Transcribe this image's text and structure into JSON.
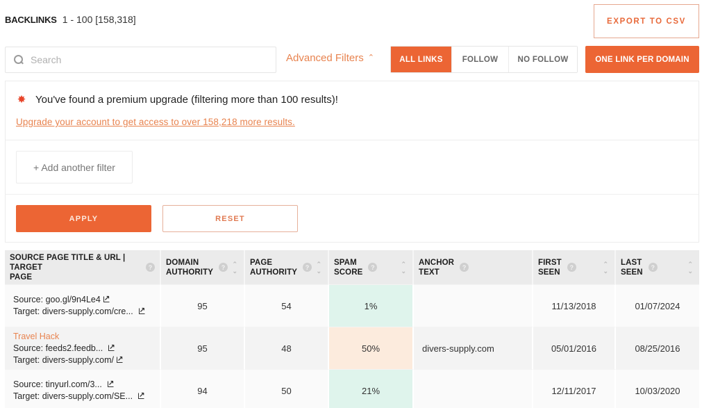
{
  "header": {
    "title": "BACKLINKS",
    "range": "1 - 100 [158,318]",
    "export_label": "EXPORT TO CSV"
  },
  "toolbar": {
    "search_placeholder": "Search",
    "search_value": "",
    "advanced_filters_label": "Advanced Filters",
    "advanced_filters_icon": "chevron-up-icon",
    "link_filters": [
      {
        "label": "ALL LINKS",
        "active": true
      },
      {
        "label": "FOLLOW",
        "active": false
      },
      {
        "label": "NO FOLLOW",
        "active": false
      }
    ],
    "one_link_per_domain_label": "ONE LINK PER DOMAIN"
  },
  "filter_panel": {
    "premium_icon": "burst-icon",
    "premium_message": "You've found a premium upgrade (filtering more than 100 results)!",
    "upgrade_link": "Upgrade your account to get access to over 158,218 more results.",
    "add_filter_label": "+ Add another filter",
    "apply_label": "APPLY",
    "reset_label": "RESET"
  },
  "table": {
    "columns": [
      {
        "label_line1": "SOURCE PAGE TITLE & URL | TARGET",
        "label_line2": "PAGE",
        "help": true,
        "sortable": false
      },
      {
        "label_line1": "DOMAIN",
        "label_line2": "AUTHORITY",
        "help": true,
        "sortable": true
      },
      {
        "label_line1": "PAGE",
        "label_line2": "AUTHORITY",
        "help": true,
        "sortable": true
      },
      {
        "label_line1": "SPAM",
        "label_line2": "SCORE",
        "help": true,
        "sortable": true
      },
      {
        "label_line1": "ANCHOR",
        "label_line2": "TEXT",
        "help": true,
        "sortable": false
      },
      {
        "label_line1": "FIRST",
        "label_line2": "SEEN",
        "help": true,
        "sortable": true
      },
      {
        "label_line1": "LAST",
        "label_line2": "SEEN",
        "help": true,
        "sortable": true
      }
    ],
    "rows": [
      {
        "page_title": "",
        "source": "goo.gl/9n4Le4",
        "target": "divers-supply.com/cre...",
        "domain_authority": "95",
        "page_authority": "54",
        "spam_score": "1%",
        "spam_level": "low",
        "anchor_text": "",
        "first_seen": "11/13/2018",
        "last_seen": "01/07/2024"
      },
      {
        "page_title": "Travel Hack",
        "source": "feeds2.feedb...",
        "target": "divers-supply.com/",
        "domain_authority": "95",
        "page_authority": "48",
        "spam_score": "50%",
        "spam_level": "medium",
        "anchor_text": "divers-supply.com",
        "first_seen": "05/01/2016",
        "last_seen": "08/25/2016"
      },
      {
        "page_title": "",
        "source": "tinyurl.com/3...",
        "target": "divers-supply.com/SE...",
        "domain_authority": "94",
        "page_authority": "50",
        "spam_score": "21%",
        "spam_level": "low",
        "anchor_text": "",
        "first_seen": "12/11/2017",
        "last_seen": "10/03/2020"
      }
    ],
    "source_prefix": "Source: ",
    "target_prefix": "Target: "
  },
  "colors": {
    "accent": "#ec6534",
    "link": "#e8834f",
    "spam_low_bg": "#dff4ec",
    "spam_medium_bg": "#fcebdd"
  }
}
